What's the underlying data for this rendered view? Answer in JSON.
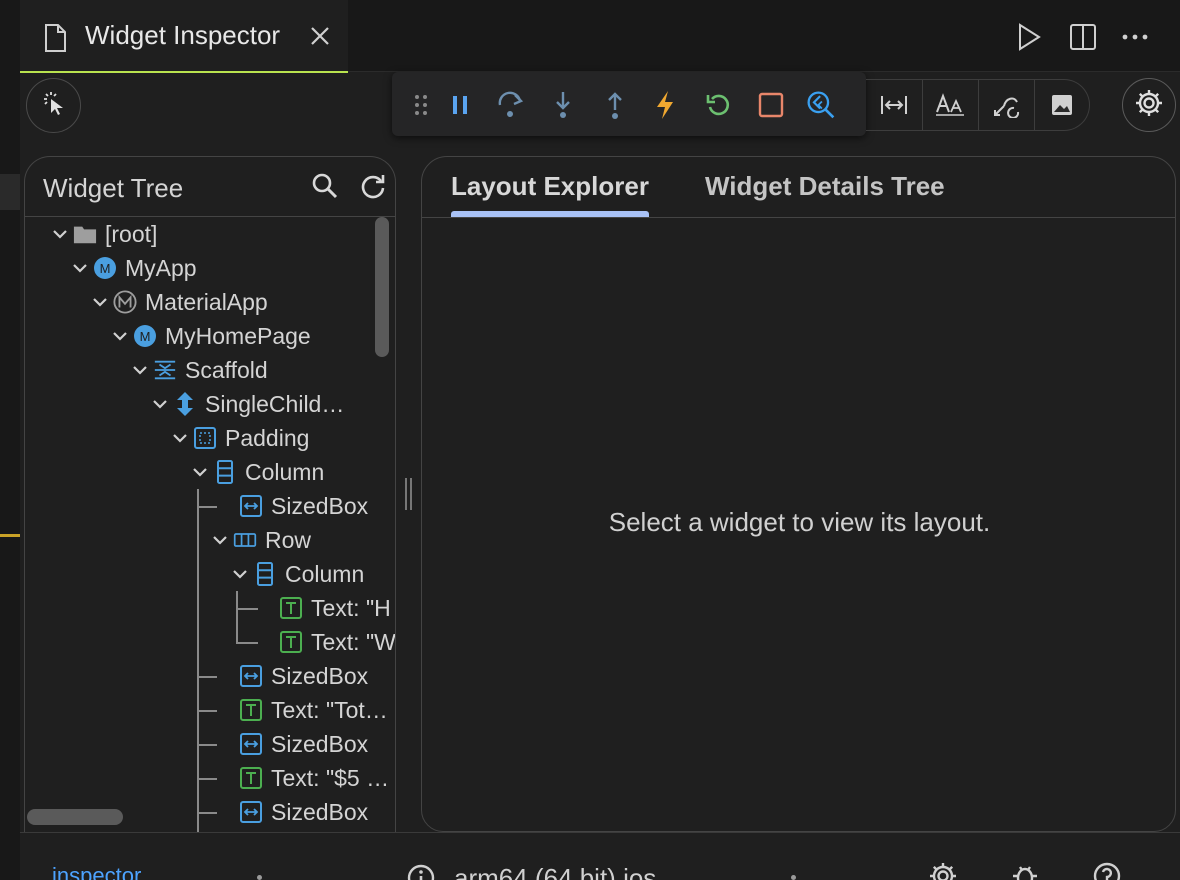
{
  "editor_tab": {
    "title": "Widget Inspector",
    "file_icon": "file-icon",
    "close_icon": "close-icon",
    "actions": [
      "run-icon",
      "split-editor-icon",
      "more-actions-icon"
    ]
  },
  "toolbar": {
    "inspect_icon": "select-widget-mode-icon",
    "debug_controls": [
      "drag-handle-icon",
      "pause-icon",
      "step-over-icon",
      "step-into-icon",
      "step-out-icon",
      "hot-reload-icon",
      "hot-restart-icon",
      "stop-icon",
      "open-devtools-icon"
    ],
    "toggles": [
      "show-guidelines-icon",
      "show-baselines-icon",
      "highlight-repaints-icon",
      "highlight-oversized-images-icon"
    ],
    "settings_icon": "gear-icon",
    "colors": {
      "pause": "#5aa4f0",
      "step": "#6d8fae",
      "hot_reload": "#f0a830",
      "hot_restart": "#6cc070",
      "stop": "#e8866a",
      "devtools": "#3aa0f0"
    }
  },
  "widget_tree": {
    "title": "Widget Tree",
    "nodes": [
      {
        "label": "[root]",
        "icon": "folder-icon"
      },
      {
        "label": "MyApp",
        "icon": "m-badge-icon"
      },
      {
        "label": "MaterialApp",
        "icon": "material-app-icon"
      },
      {
        "label": "MyHomePage",
        "icon": "m-badge-icon"
      },
      {
        "label": "Scaffold",
        "icon": "scaffold-icon"
      },
      {
        "label": "SingleChild…",
        "icon": "scroll-view-icon"
      },
      {
        "label": "Padding",
        "icon": "padding-icon"
      },
      {
        "label": "Column",
        "icon": "column-icon"
      },
      {
        "label": "SizedBox",
        "icon": "sizedbox-icon"
      },
      {
        "label": "Row",
        "icon": "row-icon"
      },
      {
        "label": "Column",
        "icon": "column-icon"
      },
      {
        "label": "Text: \"H",
        "icon": "text-icon"
      },
      {
        "label": "Text: \"W",
        "icon": "text-icon"
      },
      {
        "label": "SizedBox",
        "icon": "sizedbox-icon"
      },
      {
        "label": "Text: \"Tot…",
        "icon": "text-icon"
      },
      {
        "label": "SizedBox",
        "icon": "sizedbox-icon"
      },
      {
        "label": "Text: \"$5 …",
        "icon": "text-icon"
      },
      {
        "label": "SizedBox",
        "icon": "sizedbox-icon"
      }
    ],
    "colors": {
      "blue": "#4a9fe0",
      "green": "#4caf50",
      "grey": "#9e9e9e"
    }
  },
  "details": {
    "tabs": [
      "Layout Explorer",
      "Widget Details Tree"
    ],
    "active_tab": "Layout Explorer",
    "empty_message": "Select a widget to view its layout."
  },
  "statusbar": {
    "link": "inspector",
    "device": "arm64 (64 bit) ios",
    "icons": [
      "info-icon",
      "gear-icon",
      "bug-icon",
      "help-icon"
    ]
  }
}
